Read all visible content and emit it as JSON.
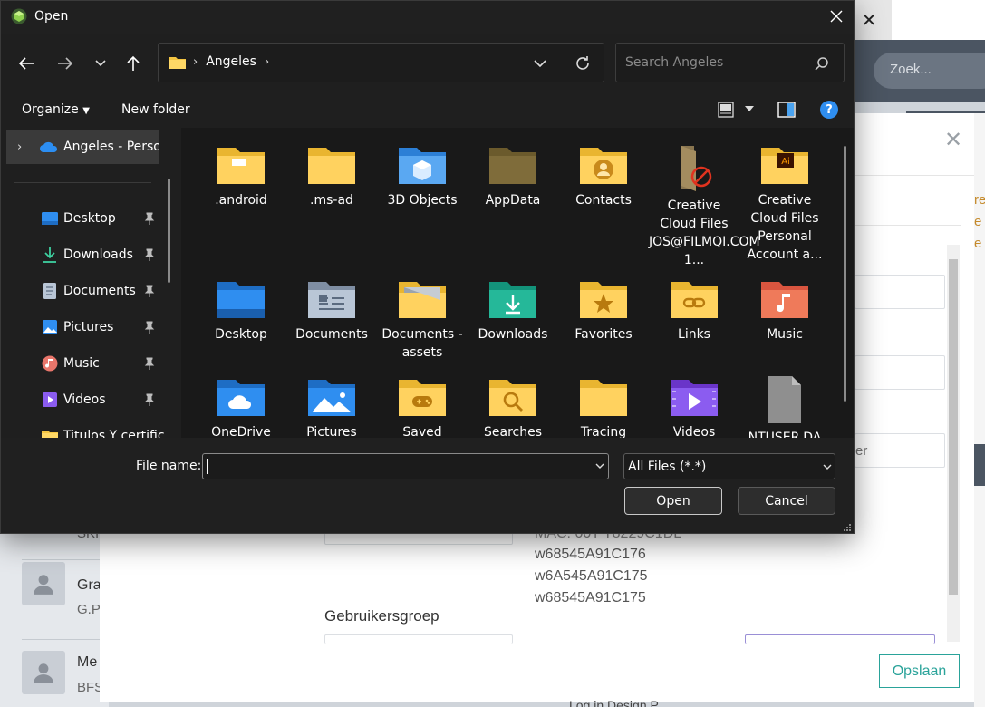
{
  "background": {
    "tab_close": "✕",
    "search_placeholder": "Zoek...",
    "people": [
      {
        "name": "Gra",
        "sub": "G.P"
      },
      {
        "name": "Me",
        "sub": "BFS"
      }
    ],
    "partial_sub_top": "SKI",
    "mac_lines": [
      "MAC: 00T T8229C1DL",
      "w68545A91C176",
      "w6A545A91C175",
      "w68545A91C175"
    ],
    "group_label": "Gebruikersgroep",
    "partial_field_text": "er",
    "save_button": "Opslaan",
    "bottom_partial_text": "Log in Design P",
    "colors": {
      "accent": "#2aa39a",
      "header": "#4b5562"
    }
  },
  "dialog": {
    "title": "Open",
    "address": {
      "path": [
        "Angeles"
      ]
    },
    "search_placeholder": "Search Angeles",
    "commands": {
      "organize": "Organize",
      "new_folder": "New folder",
      "help": "?"
    },
    "nav_tree": [
      {
        "label": "Angeles - Personal",
        "icon": "onedrive-icon",
        "selected": true
      },
      {
        "label": "Desktop",
        "icon": "desktop-icon",
        "pinned": true
      },
      {
        "label": "Downloads",
        "icon": "download-icon",
        "pinned": true
      },
      {
        "label": "Documents",
        "icon": "document-icon",
        "pinned": true
      },
      {
        "label": "Pictures",
        "icon": "pictures-icon",
        "pinned": true
      },
      {
        "label": "Music",
        "icon": "music-icon",
        "pinned": true
      },
      {
        "label": "Videos",
        "icon": "videos-icon",
        "pinned": true
      },
      {
        "label": "Titulos Y certific",
        "icon": "folder-icon",
        "pinned": false
      }
    ],
    "items": [
      {
        "label": ".android",
        "icon": "folder-plain-icon"
      },
      {
        "label": ".ms-ad",
        "icon": "folder-plain-icon"
      },
      {
        "label": "3D Objects",
        "icon": "folder-3d-icon"
      },
      {
        "label": "AppData",
        "icon": "folder-dim-icon"
      },
      {
        "label": "Contacts",
        "icon": "folder-contacts-icon"
      },
      {
        "label": "Creative Cloud Files JOS@FILMQI.COM 1...",
        "icon": "folder-cc-icon"
      },
      {
        "label": "Creative Cloud Files Personal Account a...",
        "icon": "folder-ai-icon"
      },
      {
        "label": "Desktop",
        "icon": "folder-desktop-icon"
      },
      {
        "label": "Documents",
        "icon": "folder-documents-icon"
      },
      {
        "label": "Documents -assets",
        "icon": "folder-assets-icon"
      },
      {
        "label": "Downloads",
        "icon": "folder-downloads-icon"
      },
      {
        "label": "Favorites",
        "icon": "folder-favorites-icon"
      },
      {
        "label": "Links",
        "icon": "folder-links-icon"
      },
      {
        "label": "Music",
        "icon": "folder-music-icon"
      },
      {
        "label": "OneDrive",
        "icon": "folder-onedrive-icon"
      },
      {
        "label": "Pictures",
        "icon": "folder-pictures-icon"
      },
      {
        "label": "Saved",
        "icon": "folder-saved-icon"
      },
      {
        "label": "Searches",
        "icon": "folder-searches-icon"
      },
      {
        "label": "Tracing",
        "icon": "folder-plain-icon"
      },
      {
        "label": "Videos",
        "icon": "folder-videos-icon"
      },
      {
        "label": "NTUSER.DA",
        "icon": "file-icon"
      }
    ],
    "file_name_label": "File name:",
    "file_name_value": "",
    "file_type": "All Files (*.*)",
    "open_button": "Open",
    "cancel_button": "Cancel"
  }
}
